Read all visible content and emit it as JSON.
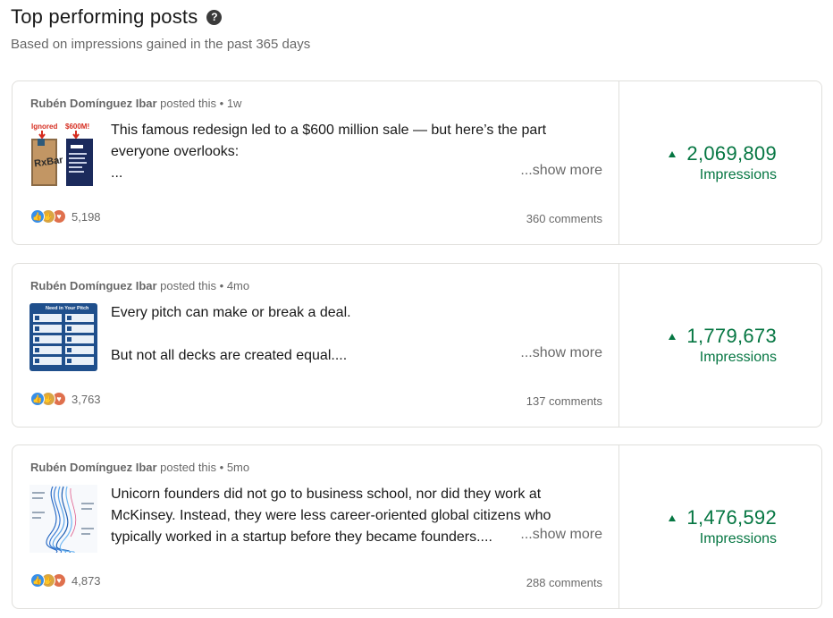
{
  "header": {
    "title": "Top performing posts",
    "help_icon": "question-circle-icon",
    "subtitle": "Based on impressions gained in the past 365 days"
  },
  "colors": {
    "metric_green": "#057642",
    "border": "#e0dfdc",
    "muted_text": "#666666"
  },
  "posts": [
    {
      "author": "Rubén Domínguez Ibar",
      "posted_suffix": " posted this • 1w",
      "thumbnail": "rxbar-packaging-thumbnail",
      "thumb_labels": [
        "Ignored",
        "$600M!"
      ],
      "text_lines": [
        "This famous redesign led to a $600 million sale — but here’s the part",
        "everyone overlooks:",
        "..."
      ],
      "show_more": "...show more",
      "reaction_icons": [
        "like-icon",
        "celebrate-icon",
        "love-icon"
      ],
      "reaction_count": "5,198",
      "comments": "360 comments",
      "impressions_value": "2,069,809",
      "impressions_label": "Impressions",
      "trend": "up"
    },
    {
      "author": "Rubén Domínguez Ibar",
      "posted_suffix": " posted this • 4mo",
      "thumbnail": "pitch-deck-infographic-thumbnail",
      "thumb_labels": [
        "Need in Your Pitch"
      ],
      "text_lines": [
        "Every pitch can make or break a deal.",
        "",
        "But not all decks are created equal...."
      ],
      "show_more": "...show more",
      "reaction_icons": [
        "like-icon",
        "celebrate-icon",
        "love-icon"
      ],
      "reaction_count": "3,763",
      "comments": "137 comments",
      "impressions_value": "1,779,673",
      "impressions_label": "Impressions",
      "trend": "up"
    },
    {
      "author": "Rubén Domínguez Ibar",
      "posted_suffix": " posted this • 5mo",
      "thumbnail": "founder-paths-diagram-thumbnail",
      "thumb_labels": [],
      "text_lines": [
        "Unicorn founders did not go to business school, nor did they work at",
        "McKinsey. Instead, they were less career-oriented global citizens who",
        "typically worked in a startup before they became founders...."
      ],
      "show_more": "...show more",
      "reaction_icons": [
        "like-icon",
        "celebrate-icon",
        "love-icon"
      ],
      "reaction_count": "4,873",
      "comments": "288 comments",
      "impressions_value": "1,476,592",
      "impressions_label": "Impressions",
      "trend": "up"
    }
  ]
}
